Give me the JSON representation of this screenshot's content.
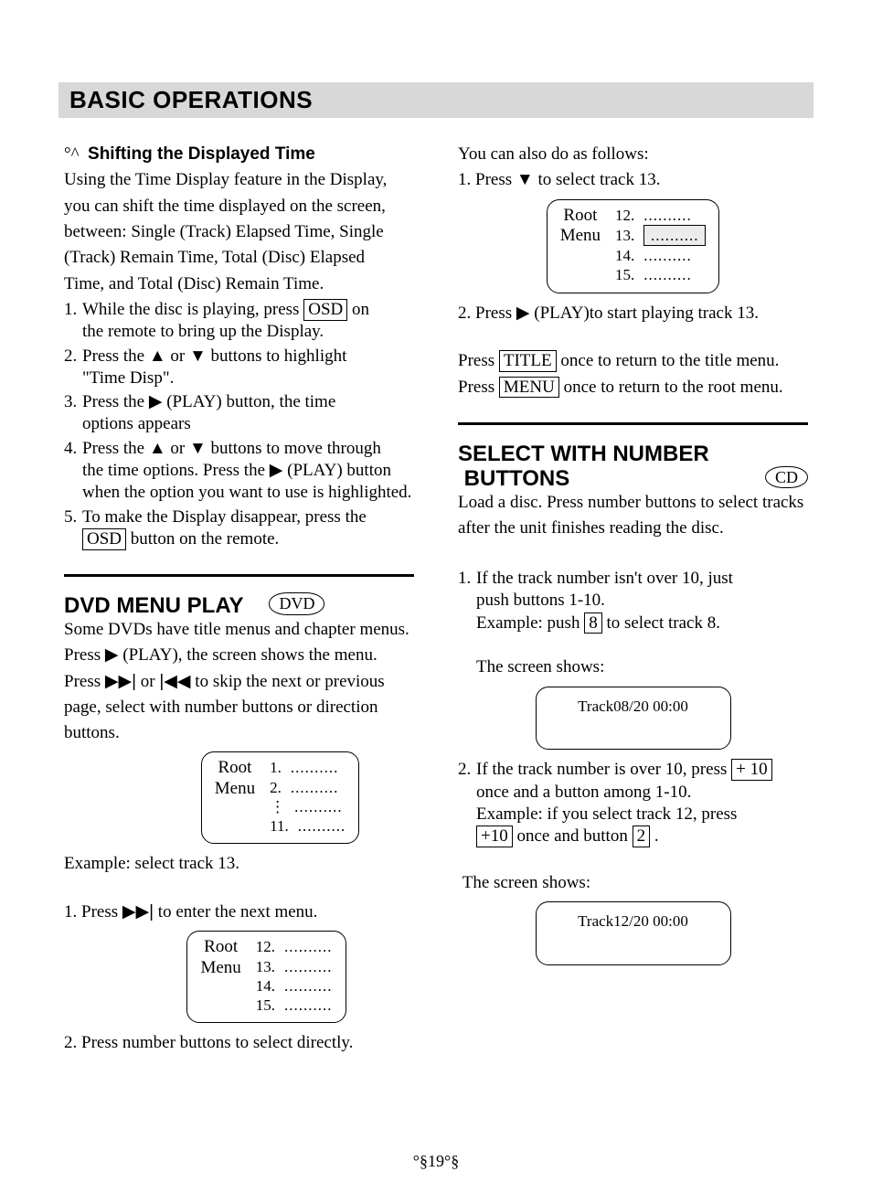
{
  "heading": "BASIC OPERATIONS",
  "shift": {
    "degrees": "°^",
    "title": "Shifting the Displayed Time",
    "intro1": "Using the Time Display feature in the Display,",
    "intro2": "you can shift the time displayed on the screen,",
    "intro3": "between: Single (Track) Elapsed Time, Single",
    "intro4": "(Track) Remain Time, Total (Disc) Elapsed",
    "intro5": "Time, and Total (Disc) Remain Time.",
    "s1a": "While the disc is playing, press ",
    "s1key": "OSD",
    "s1b": " on",
    "s1c": "the remote to bring up the Display.",
    "s2a": "Press the ",
    "up": "▲",
    "s2b": " or ",
    "down": "▼",
    "s2c": " buttons to highlight",
    "s2d": "\"Time Disp\".",
    "s3a": "Press the ",
    "play": "▶",
    "s3b": " (PLAY) button, the time",
    "s3c": "options appears",
    "s4a": "Press the ",
    "s4b": " or ",
    "s4c": " buttons to move through",
    "s4d": "the time options. Press the ",
    "s4e": " (PLAY) button",
    "s4f": "when the option you want to use is highlighted.",
    "s5a": "To make the Display disappear, press the",
    "s5key": "OSD",
    "s5b": " button on the remote."
  },
  "dvd": {
    "title": "DVD MENU PLAY",
    "badge": "DVD",
    "p1": "Some DVDs have title menus and chapter menus.",
    "p2a": "Press ",
    "play": "▶",
    "p2b": " (PLAY), the screen shows the menu.",
    "p3a": "Press ",
    "next": "▶▶|",
    "p3b": " or ",
    "prev": "|◀◀",
    "p3c": " to  skip the next or previous",
    "p4": "page, select with number buttons or direction",
    "p5": "buttons.",
    "menu1": {
      "root": "Root",
      "menu": "Menu",
      "r1": "1.",
      "r2": "2.",
      "rvdots": "⋮",
      "r11": "11.",
      "dots": ".........."
    },
    "example": "Example: select track 13.",
    "step1a": "1. Press ",
    "step1b": " to enter the next menu.",
    "menu2": {
      "root": "Root",
      "menu": "Menu",
      "r12": "12.",
      "r13": "13.",
      "r14": "14.",
      "r15": "15.",
      "dots": ".........."
    },
    "step2": "2. Press number buttons to select directly."
  },
  "rcol": {
    "also": "You can also do as follows:",
    "s1a": "1. Press ",
    "down": "▼",
    "s1b": " to select track 13.",
    "menu3": {
      "root": "Root",
      "menu": "Menu",
      "r12": "12.",
      "r13": "13.",
      "r14": "14.",
      "r15": "15.",
      "dots": ".........."
    },
    "s2a": "2. Press ",
    "play": "▶",
    "s2b": " (PLAY)to start playing track 13.",
    "titleline_a": "Press ",
    "titleline_key": "TITLE",
    "titleline_b": " once to return to the title menu.",
    "menuline_a": "Press ",
    "menuline_key": "MENU",
    "menuline_b": " once to return to the root menu."
  },
  "num": {
    "title1": "SELECT WITH NUMBER",
    "title2": "BUTTONS",
    "badge": "CD",
    "intro1": "Load a disc. Press number buttons to select tracks",
    "intro2": "after the unit finishes reading the disc.",
    "s1a": "If the track number isn't over 10, just",
    "s1b": "push buttons 1-10.",
    "s1c_a": "Example:  push ",
    "s1c_key": "8",
    "s1c_b": " to  select  track  8.",
    "shows": "The screen shows:",
    "screen1": "Track08/20   00:00",
    "s2a_a": "If the track number is over 10, press ",
    "s2a_key": "+ 10",
    "s2b": "once and a button among 1-10.",
    "s2c": "Example: if  you  select  track  12,  press",
    "s2d_key1": "+10",
    "s2d_mid": " once and button ",
    "s2d_key2": "2",
    "s2d_end": ".",
    "shows2": "The screen shows:",
    "screen2": "Track12/20   00:00"
  },
  "chart_data": null,
  "page_number": "°§19°§"
}
